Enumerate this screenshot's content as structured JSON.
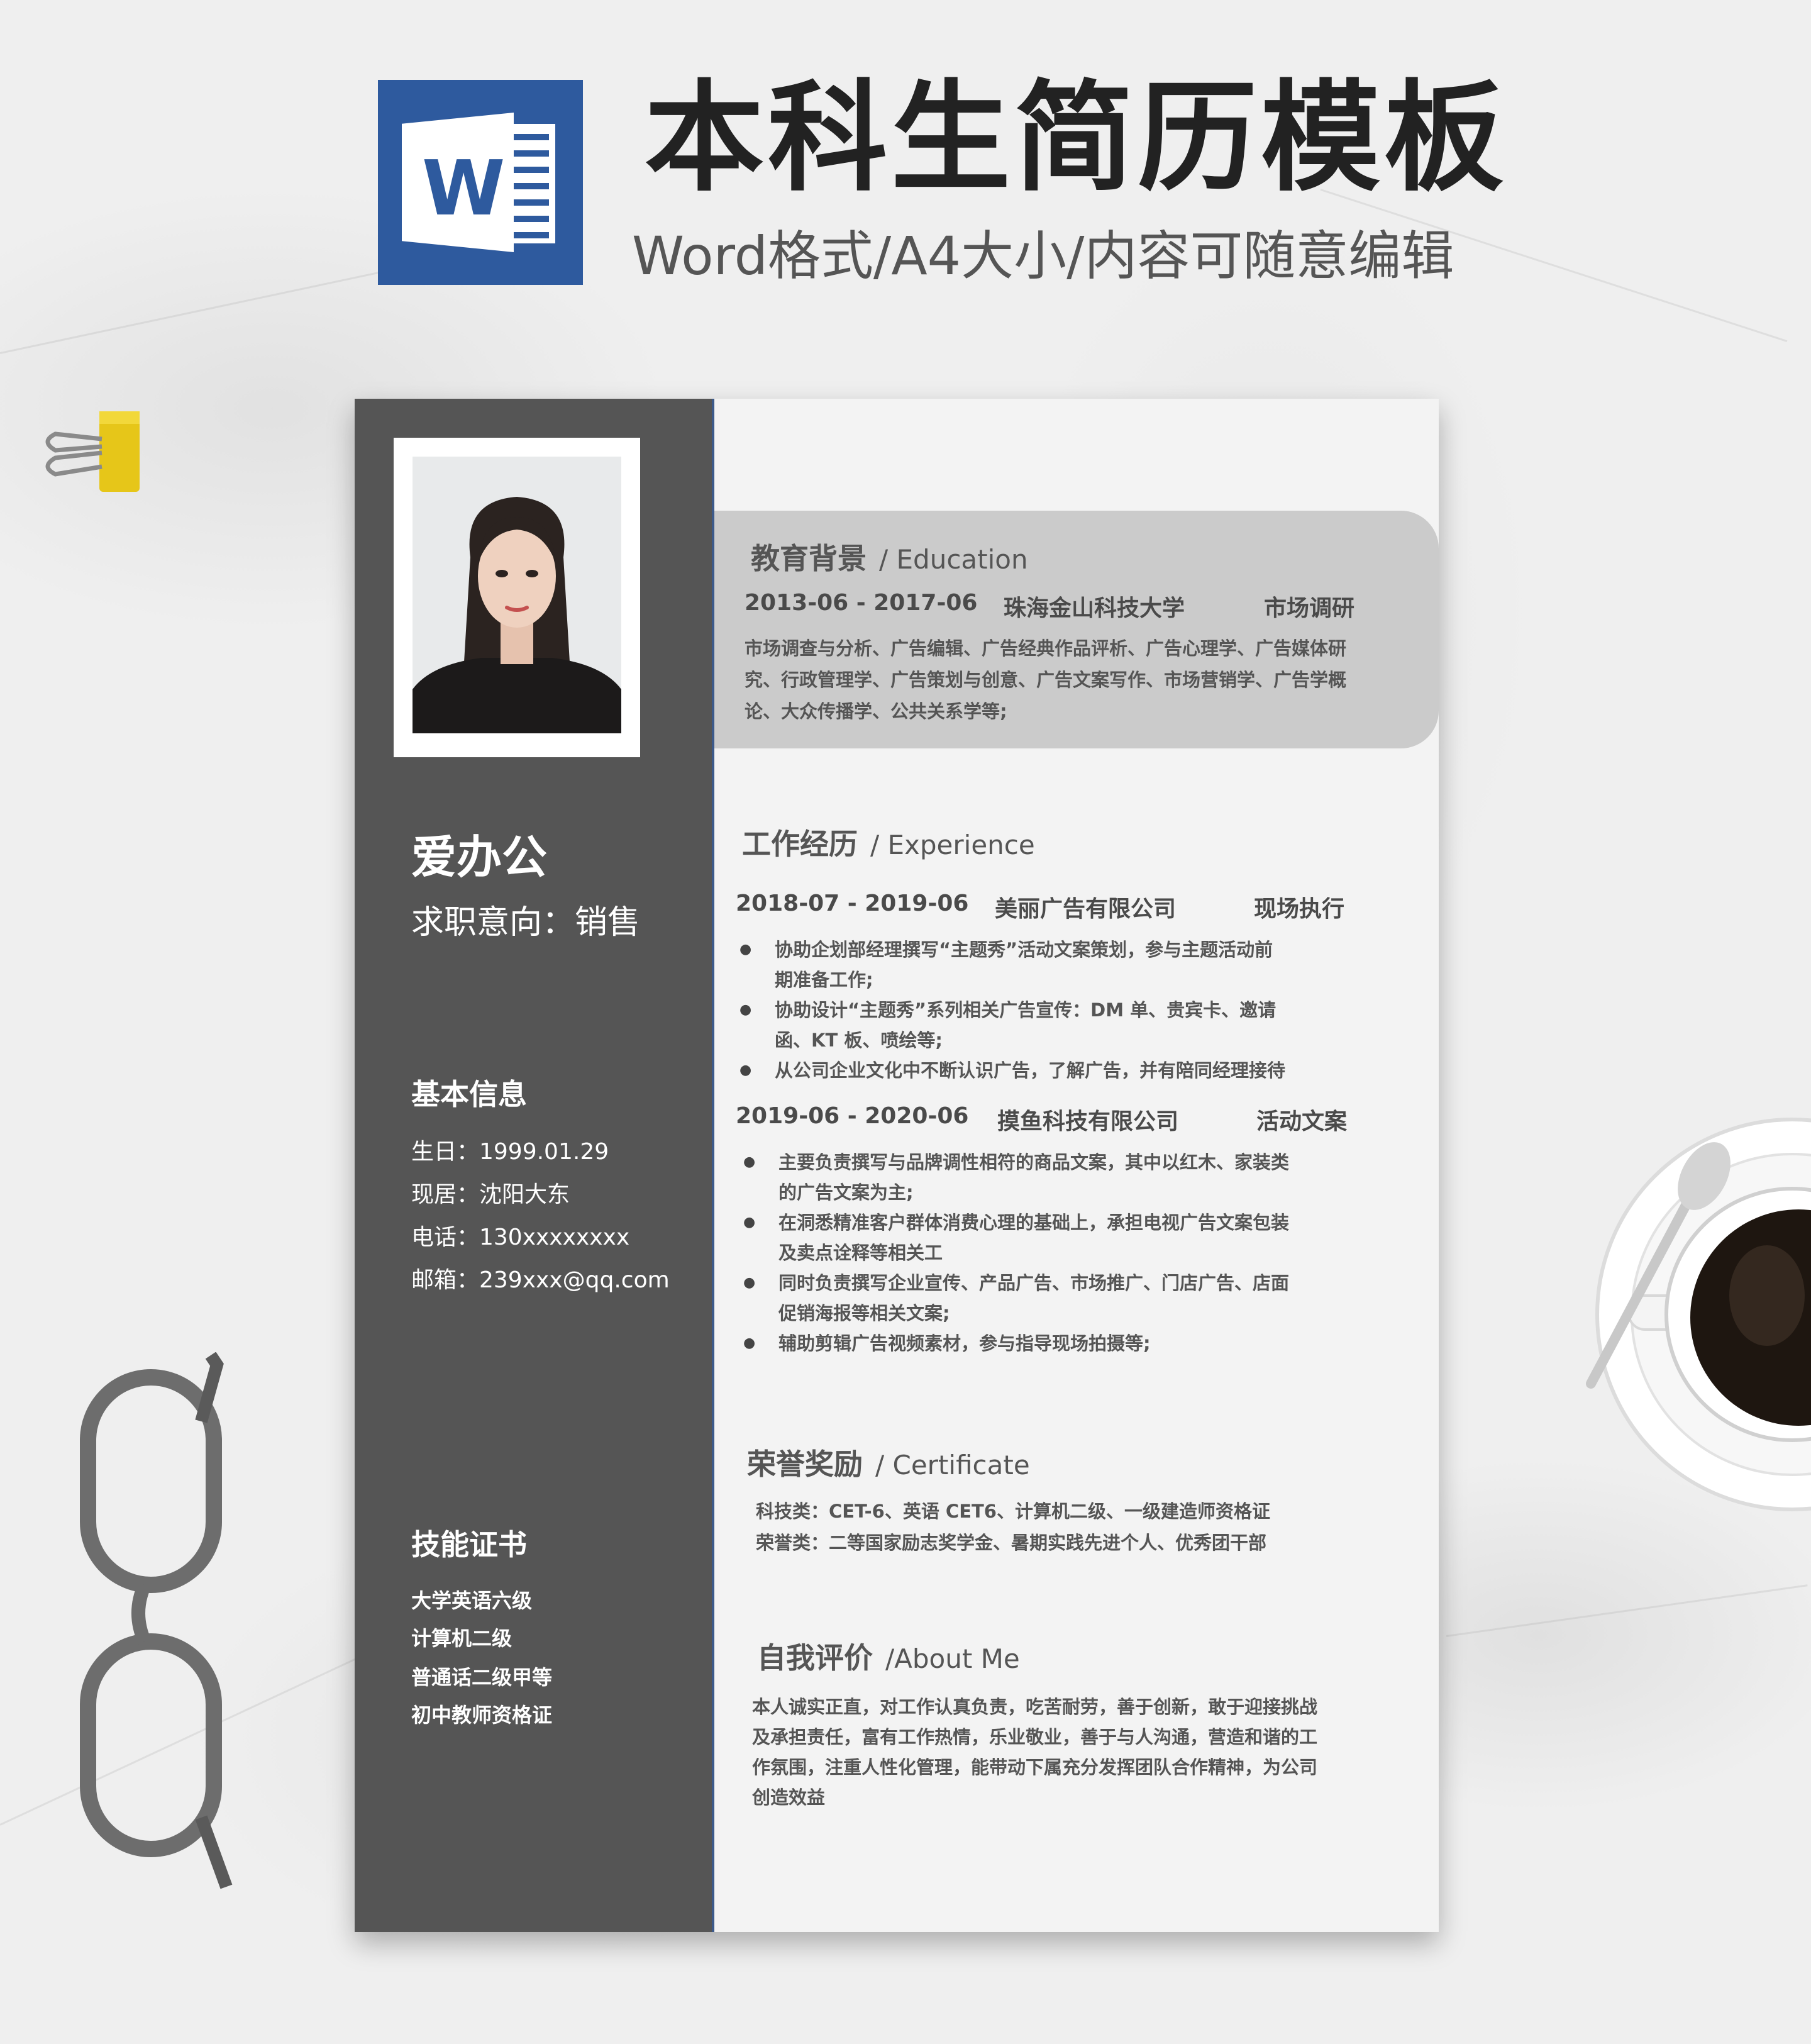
{
  "header": {
    "logo_letter": "W",
    "title": "本科生简历模板",
    "subtitle": "Word格式/A4大小/内容可随意编辑"
  },
  "profile": {
    "name": "爱办公",
    "intent": "求职意向：销售"
  },
  "basic_info": {
    "heading": "基本信息",
    "birth": "生日：1999.01.29",
    "location": "现居：沈阳大东",
    "phone": "电话：130xxxxxxxx",
    "email": "邮箱：239xxx@qq.com"
  },
  "skills": {
    "heading": "技能证书",
    "items": [
      "大学英语六级",
      "计算机二级",
      "普通话二级甲等",
      "初中教师资格证"
    ]
  },
  "education": {
    "title_cn": "教育背景",
    "title_en": "/ Education",
    "period": "2013-06 - 2017-06",
    "school": "珠海金山科技大学",
    "major": "市场调研",
    "desc": "市场调查与分析、广告编辑、广告经典作品评析、广告心理学、广告媒体研究、行政管理学、广告策划与创意、广告文案写作、市场营销学、广告学概论、大众传播学、公共关系学等;"
  },
  "experience": {
    "title_cn": "工作经历",
    "title_en": "/ Experience",
    "jobs": [
      {
        "period": "2018-07 - 2019-06",
        "company": "美丽广告有限公司",
        "role": "现场执行",
        "bullets": [
          "协助企划部经理撰写“主题秀”活动文案策划，参与主题活动前期准备工作;",
          "协助设计“主题秀”系列相关广告宣传：DM 单、贵宾卡、邀请函、KT 板、喷绘等;",
          "从公司企业文化中不断认识广告，了解广告，并有陪同经理接待"
        ]
      },
      {
        "period": "2019-06 - 2020-06",
        "company": "摸鱼科技有限公司",
        "role": "活动文案",
        "bullets": [
          "主要负责撰写与品牌调性相符的商品文案，其中以红木、家装类的广告文案为主;",
          "在洞悉精准客户群体消费心理的基础上，承担电视广告文案包装及卖点诠释等相关工",
          "同时负责撰写企业宣传、产品广告、市场推广、门店广告、店面促销海报等相关文案;",
          "辅助剪辑广告视频素材，参与指导现场拍摄等;"
        ]
      }
    ]
  },
  "honors": {
    "title_cn": "荣誉奖励",
    "title_en": "/ Certificate",
    "lines": [
      "科技类：CET-6、英语 CET6、计算机二级、一级建造师资格证",
      "荣誉类：二等国家励志奖学金、暑期实践先进个人、优秀团干部"
    ]
  },
  "about": {
    "title_cn": "自我评价",
    "title_en": "/About Me",
    "text": "本人诚实正直，对工作认真负责，吃苦耐劳，善于创新，敢于迎接挑战及承担责任，富有工作热情，乐业敬业，善于与人沟通，营造和谐的工作氛围，注重人性化管理，能带动下属充分发挥团队合作精神，为公司创造效益"
  },
  "colors": {
    "sidebar": "#555555",
    "word_blue": "#2e5a9e",
    "edu_band": "#cbcbcb"
  }
}
